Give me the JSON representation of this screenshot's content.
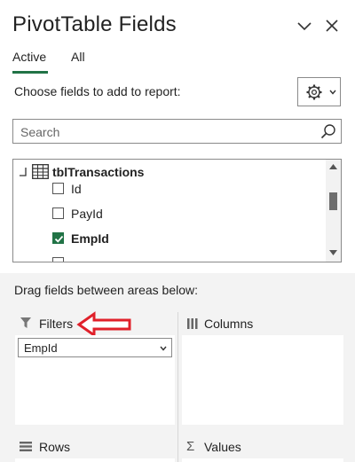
{
  "panel": {
    "title": "PivotTable Fields"
  },
  "tabs": [
    {
      "label": "Active"
    },
    {
      "label": "All"
    }
  ],
  "choose_label": "Choose fields to add to report:",
  "search": {
    "placeholder": "Search",
    "value": ""
  },
  "field_list": {
    "table_name": "tblTransactions",
    "fields": [
      {
        "name": "Id",
        "checked": false
      },
      {
        "name": "PayId",
        "checked": false
      },
      {
        "name": "EmpId",
        "checked": true
      }
    ]
  },
  "drag_label": "Drag fields between areas below:",
  "areas": {
    "filters": {
      "label": "Filters",
      "items": [
        "EmpId"
      ]
    },
    "columns": {
      "label": "Columns"
    },
    "rows": {
      "label": "Rows"
    },
    "values": {
      "label": "Values"
    }
  },
  "colors": {
    "accent": "#217346",
    "annotation_arrow": "#e0202a"
  },
  "icons": [
    "chevron-down-icon",
    "close-icon",
    "gear-icon",
    "search-icon",
    "table-icon",
    "filter-icon",
    "columns-icon",
    "rows-icon",
    "sigma-icon"
  ]
}
